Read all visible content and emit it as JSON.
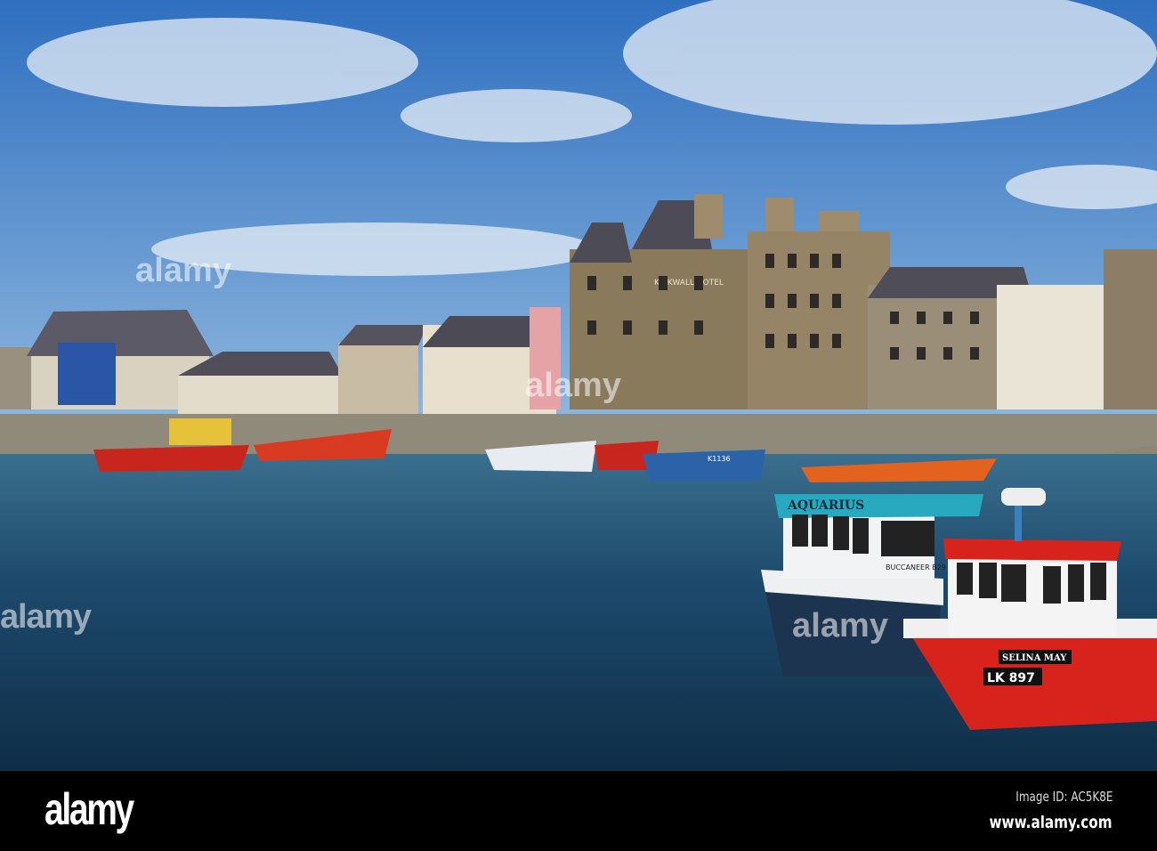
{
  "photo": {
    "subject": "harbour",
    "hotel_sign": "KIRKWALL HOTEL",
    "boats": [
      {
        "name": "AQUARIUS",
        "secondary": "BUCCANEER B29"
      },
      {
        "name": "SELINA MAY",
        "registration": "LK 897"
      },
      {
        "name": "K1136"
      }
    ],
    "watermark": "alamy"
  },
  "footer": {
    "logo": "alamy",
    "image_id": "Image ID: AC5K8E",
    "website": "www.alamy.com"
  },
  "colors": {
    "sky": "#3f7fc8",
    "water": "#1d4a6c",
    "boat_red": "#d8231c",
    "boat_teal": "#27a9c0"
  }
}
